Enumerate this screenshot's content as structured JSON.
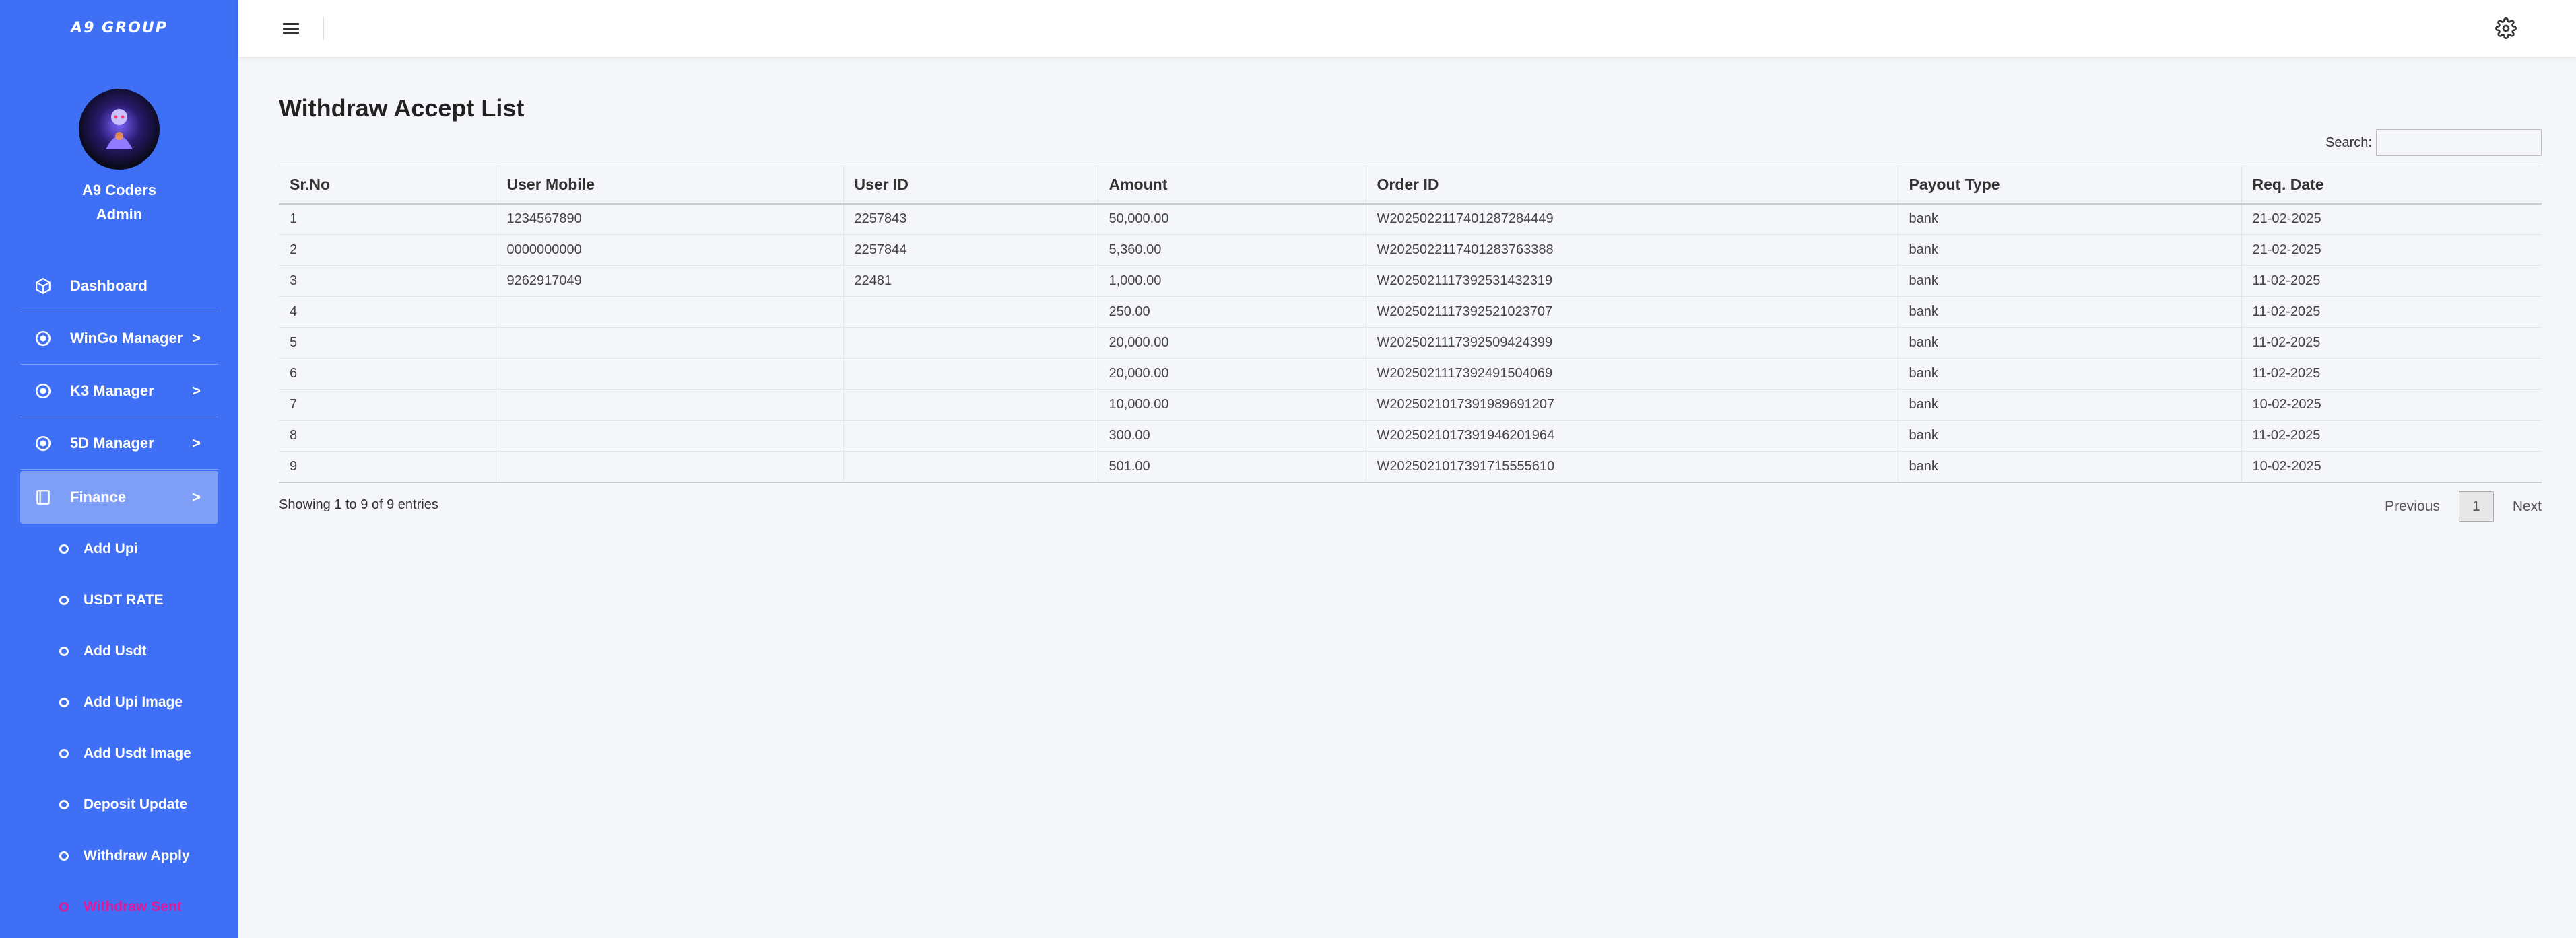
{
  "brand": "A9 GROUP",
  "user": {
    "name": "A9 Coders",
    "role": "Admin"
  },
  "nav": [
    {
      "label": "Dashboard",
      "icon": "cube-icon",
      "chevron": ""
    },
    {
      "label": "WinGo Manager",
      "icon": "target-icon",
      "chevron": ">"
    },
    {
      "label": "K3 Manager",
      "icon": "target-icon",
      "chevron": ">"
    },
    {
      "label": "5D Manager",
      "icon": "target-icon",
      "chevron": ">"
    },
    {
      "label": "Finance",
      "icon": "book-icon",
      "chevron": ">"
    }
  ],
  "finance_sub": [
    "Add Upi",
    "USDT RATE",
    "Add Usdt",
    "Add Upi Image",
    "Add Usdt Image",
    "Deposit Update",
    "Withdraw Apply",
    "Withdraw Sent"
  ],
  "page": {
    "title": "Withdraw Accept List",
    "search_label": "Search:",
    "search_value": ""
  },
  "table": {
    "headers": [
      "Sr.No",
      "User Mobile",
      "User ID",
      "Amount",
      "Order ID",
      "Payout Type",
      "Req. Date"
    ],
    "rows": [
      [
        "1",
        "1234567890",
        "2257843",
        "50,000.00",
        "W2025022117401287284449",
        "bank",
        "21-02-2025"
      ],
      [
        "2",
        "0000000000",
        "2257844",
        "5,360.00",
        "W2025022117401283763388",
        "bank",
        "21-02-2025"
      ],
      [
        "3",
        "9262917049",
        "22481",
        "1,000.00",
        "W2025021117392531432319",
        "bank",
        "11-02-2025"
      ],
      [
        "4",
        "",
        "",
        "250.00",
        "W2025021117392521023707",
        "bank",
        "11-02-2025"
      ],
      [
        "5",
        "",
        "",
        "20,000.00",
        "W2025021117392509424399",
        "bank",
        "11-02-2025"
      ],
      [
        "6",
        "",
        "",
        "20,000.00",
        "W2025021117392491504069",
        "bank",
        "11-02-2025"
      ],
      [
        "7",
        "",
        "",
        "10,000.00",
        "W2025021017391989691207",
        "bank",
        "10-02-2025"
      ],
      [
        "8",
        "",
        "",
        "300.00",
        "W2025021017391946201964",
        "bank",
        "11-02-2025"
      ],
      [
        "9",
        "",
        "",
        "501.00",
        "W2025021017391715555610",
        "bank",
        "10-02-2025"
      ]
    ]
  },
  "footer": {
    "info": "Showing 1 to 9 of 9 entries",
    "previous": "Previous",
    "page": "1",
    "next": "Next"
  }
}
